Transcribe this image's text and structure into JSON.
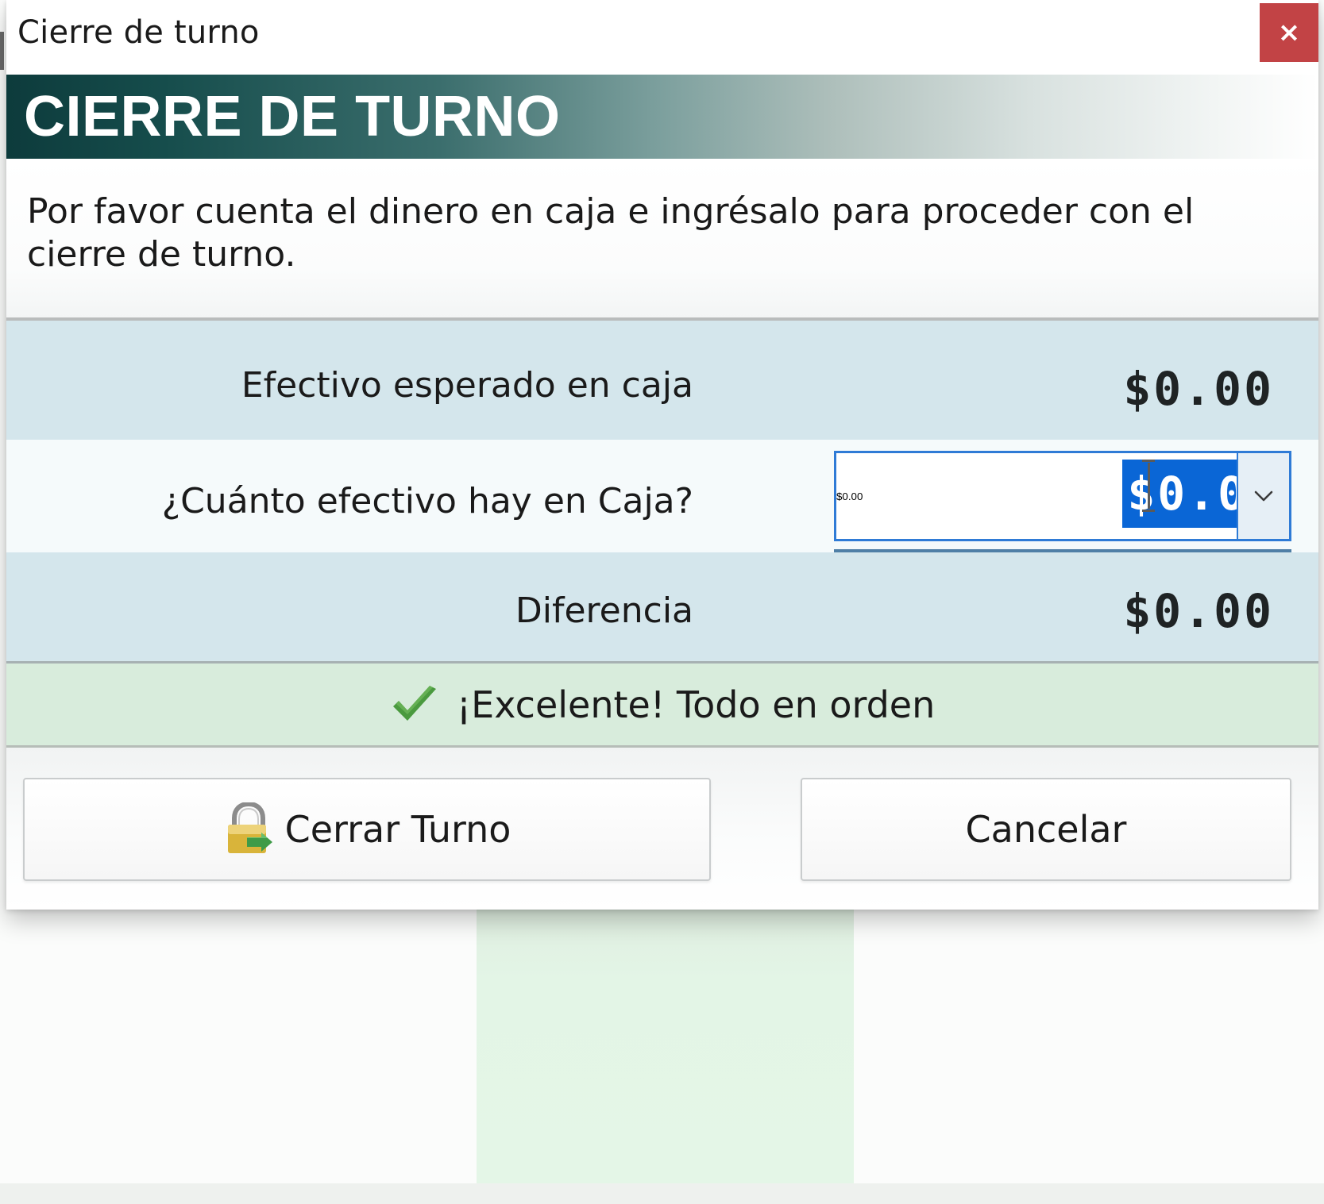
{
  "window": {
    "title": "Cierre de turno",
    "close_label": "×"
  },
  "header": {
    "title": "CIERRE DE TURNO"
  },
  "instruction": {
    "text": "Por favor cuenta el dinero en caja e ingrésalo para proceder con el cierre de turno."
  },
  "expected_cash": {
    "label": "Efectivo esperado en caja",
    "amount": "$0.00"
  },
  "counted_cash": {
    "label": "¿Cuánto efectivo hay en Caja?",
    "value": "$0.00"
  },
  "difference": {
    "label": "Diferencia",
    "amount": "$0.00"
  },
  "status": {
    "message": "¡Excelente! Todo en orden",
    "icon": "check-icon",
    "color": "#4a9a3f"
  },
  "buttons": {
    "close_shift": {
      "label": "Cerrar Turno",
      "icon": "lock-icon"
    },
    "cancel": {
      "label": "Cancelar"
    }
  },
  "colors": {
    "header_dark": "#0d3b3c",
    "row_highlight": "#d4e6ec",
    "status_background": "#d8ecdc",
    "selection": "#0a66d6",
    "close_button": "#c24345"
  }
}
